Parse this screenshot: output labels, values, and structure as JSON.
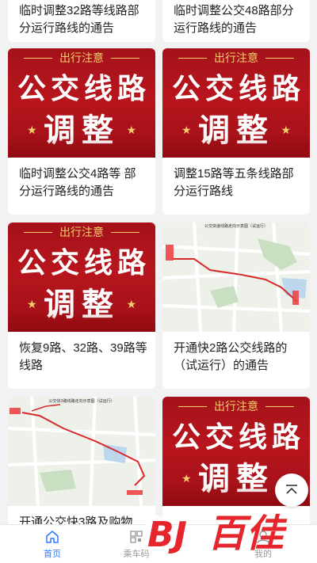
{
  "feed": {
    "cards": [
      {
        "title": "临时调整32路等线路部分运行路线的通告",
        "thumb": "poster"
      },
      {
        "title": "临时调整公交48路部分运行路线的通告",
        "thumb": "poster"
      },
      {
        "title": "临时调整公交4路等 部分运行路线的通告",
        "thumb": "poster"
      },
      {
        "title": "调整15路等五条线路部分运行路线",
        "thumb": "poster"
      },
      {
        "title": "恢复9路、32路、39路等线路",
        "thumb": "poster"
      },
      {
        "title": "开通快2路公交线路的（试运行）的通告",
        "thumb": "map"
      },
      {
        "title": "开通公交快3路及购物",
        "thumb": "map"
      },
      {
        "title": "",
        "thumb": "poster"
      }
    ],
    "poster": {
      "header": "出行注意",
      "line1": [
        "公",
        "交",
        "线",
        "路"
      ],
      "line2": "调整"
    },
    "map_labels": {
      "map1_caption": "公交快速线路走向示意图（试运行）",
      "map2_caption": "公交快3路线路走向示意图（试运行）"
    }
  },
  "tabbar": {
    "tabs": [
      {
        "label": "首页",
        "icon": "home-icon",
        "active": true
      },
      {
        "label": "乘车码",
        "icon": "qrcode-icon",
        "active": false
      },
      {
        "label": "",
        "icon": "blank",
        "active": false
      },
      {
        "label": "我的",
        "icon": "user-icon",
        "active": false
      }
    ]
  },
  "watermark": {
    "text": "百佳",
    "logo": "BJ"
  },
  "colors": {
    "accent": "#2979ff",
    "poster_red": "#b8151d",
    "poster_gold": "#f3cf6a",
    "watermark_red": "#e5262d"
  }
}
